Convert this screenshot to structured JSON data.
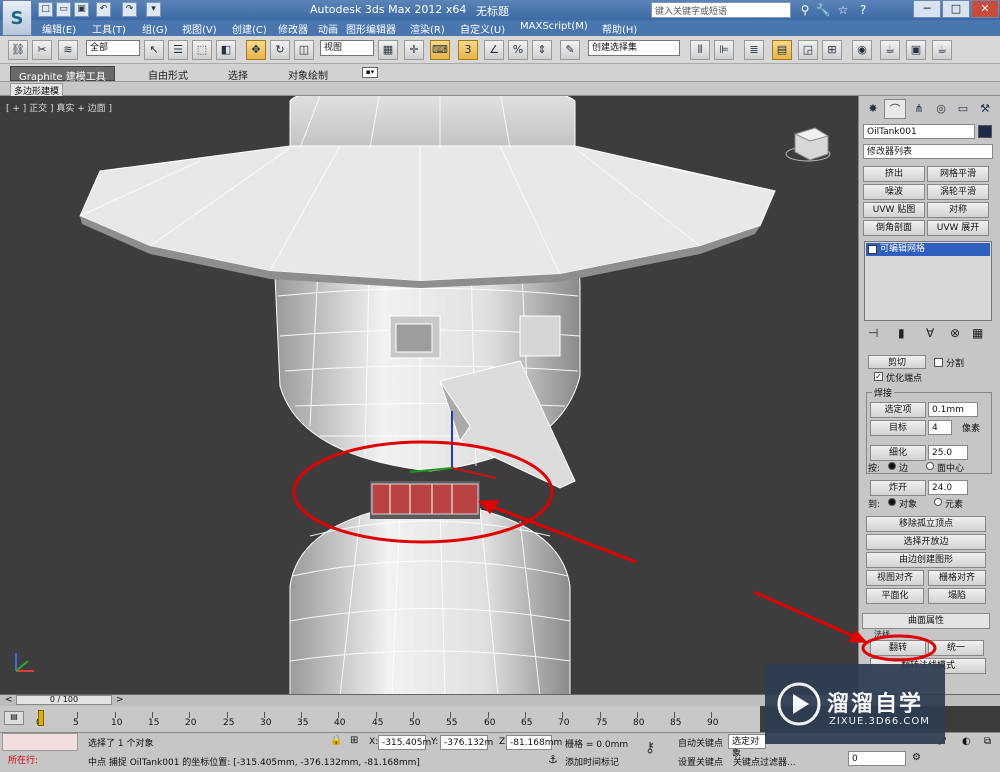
{
  "title_bar": {
    "logo_text": "S",
    "app_title": "Autodesk 3ds Max  2012 x64",
    "doc_name": "无标题",
    "search_placeholder": "键入关键字或短语",
    "quick_access": [
      "□",
      "▭",
      "▣",
      "↶",
      "↷",
      "▾"
    ],
    "tools": [
      "⚲",
      "🔧",
      "☆",
      "?"
    ],
    "window_controls": [
      "─",
      "□",
      "✕"
    ]
  },
  "menu": [
    "编辑(E)",
    "工具(T)",
    "组(G)",
    "视图(V)",
    "创建(C)",
    "修改器",
    "动画",
    "图形编辑器",
    "渲染(R)",
    "自定义(U)",
    "MAXScript(M)",
    "帮助(H)"
  ],
  "toolbar": {
    "selection_filter": "全部",
    "ref_coord": "视图",
    "named_selection": "创建选择集"
  },
  "ribbon": {
    "tabs": [
      "Graphite 建模工具",
      "自由形式",
      "选择",
      "对象绘制"
    ],
    "sub_tab": "多边形建模"
  },
  "viewport": {
    "label": "[ + ] 正交 ] 真实 + 边面 ]"
  },
  "command_panel": {
    "object_name": "OilTank001",
    "modifier_list": "修改器列表",
    "modifier_buttons": [
      [
        "挤出",
        "网格平滑"
      ],
      [
        "噪波",
        "涡轮平滑"
      ],
      [
        "UVW 贴图",
        "对称"
      ],
      [
        "倒角剖面",
        "UVW 展开"
      ]
    ],
    "stack_item": "可编辑网格",
    "cut_label": "剪切",
    "split_label": "分割",
    "optimize_label": "优化端点",
    "weld_group": "焊接",
    "selected_label": "选定项",
    "selected_value": "0.1mm",
    "target_label": "目标",
    "target_value": "4",
    "pixel_label": "像素",
    "tessellate_label": "细化",
    "tessellate_value": "25.0",
    "by_label": "按:",
    "edge_label": "边",
    "face_center_label": "面中心",
    "explode_label": "炸开",
    "explode_value": "24.0",
    "to_label": "到:",
    "object_label": "对象",
    "element_label": "元素",
    "buttons": [
      "移除孤立顶点",
      "选择开放边",
      "由边创建图形"
    ],
    "align_view": "视图对齐",
    "align_grid": "栅格对齐",
    "flatten": "平面化",
    "collapse": "塌陷",
    "surface_props": "曲面属性",
    "normals_label": "法线",
    "flip": "翻转",
    "unify": "统一",
    "flip_normal_mode": "翻转法线模式"
  },
  "timeline": {
    "frame": "0 / 100",
    "ticks": [
      "0",
      "5",
      "10",
      "15",
      "20",
      "25",
      "30",
      "35",
      "40",
      "45",
      "50",
      "55",
      "60",
      "65",
      "70",
      "75",
      "80",
      "85",
      "90"
    ]
  },
  "status": {
    "running_label": "所在行:",
    "selection_msg": "选择了 1 个对象",
    "prompt": "中点 捕捉 OilTank001 的坐标位置: [-315.405mm, -376.132mm, -81.168mm]",
    "x_label": "X:",
    "x": "-315.405m",
    "y_label": "Y:",
    "y": "-376.132m",
    "z_label": "Z:",
    "z": "-81.168mm",
    "grid": "栅格 = 0.0mm",
    "add_time_tag": "添加时间标记",
    "auto_key": "自动关键点",
    "set_key": "设置关键点",
    "selected_obj": "选定对象",
    "key_filters": "关键点过滤器...",
    "frame_field": "0"
  },
  "watermark": {
    "brand": "溜溜自学",
    "url": "ZIXUE.3D66.COM"
  },
  "colors": {
    "title_bar": "#3c6aa5",
    "viewport_bg": "#3d3d3d",
    "annotation_red": "#e00000",
    "highlight_face": "#d93b3b",
    "stack_item": "#2f5fbf"
  }
}
